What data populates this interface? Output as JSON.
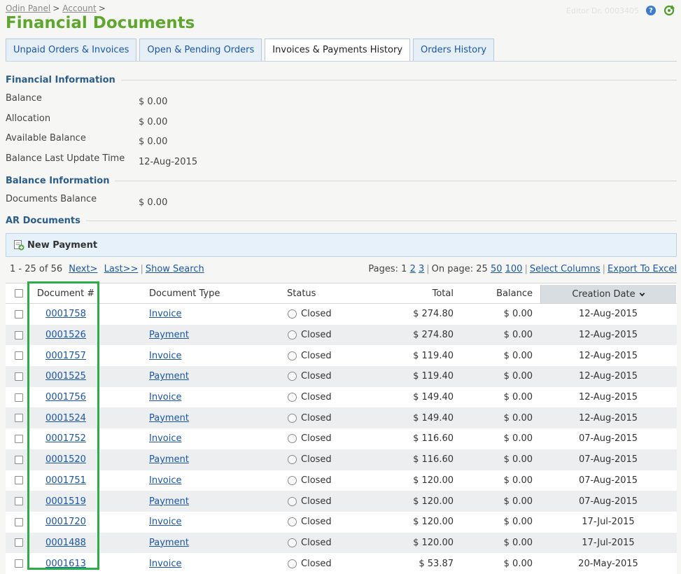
{
  "breadcrumb": {
    "items": [
      "Odin Panel",
      "Account"
    ],
    "separator": ">"
  },
  "header": {
    "faint_text": "Editor  Dr. 0003405",
    "help_icon": "help-icon",
    "refresh_icon": "refresh-icon",
    "title": "Financial Documents",
    "title_color": "#5fa62c"
  },
  "tabs": [
    {
      "label": "Unpaid Orders & Invoices",
      "active": false
    },
    {
      "label": "Open & Pending Orders",
      "active": false
    },
    {
      "label": "Invoices & Payments History",
      "active": true
    },
    {
      "label": "Orders History",
      "active": false
    }
  ],
  "financial_info": {
    "title": "Financial Information",
    "rows": [
      {
        "label": "Balance",
        "value": "$ 0.00"
      },
      {
        "label": "Allocation",
        "value": "$ 0.00"
      },
      {
        "label": "Available Balance",
        "value": "$ 0.00"
      },
      {
        "label": "Balance Last Update Time",
        "value": "12-Aug-2015"
      }
    ]
  },
  "balance_info": {
    "title": "Balance Information",
    "rows": [
      {
        "label": "Documents Balance",
        "value": "$ 0.00"
      }
    ]
  },
  "ar_documents": {
    "title": "AR Documents",
    "new_payment_label": "New Payment",
    "new_payment_icon": "add-document-icon"
  },
  "pager": {
    "range": "1 -  25 of 56",
    "next": "Next>",
    "last": "Last>>",
    "show_search": "Show Search",
    "pages_label": "Pages: 1",
    "page2": "2",
    "page3": "3",
    "on_page_label": "On page: 25",
    "size50": "50",
    "size100": "100",
    "select_columns": "Select Columns",
    "export": "Export To Excel"
  },
  "table": {
    "columns": {
      "document": "Document #",
      "type": "Document Type",
      "status": "Status",
      "total": "Total",
      "balance": "Balance",
      "date": "Creation Date"
    },
    "sorted_column": "Creation Date",
    "sort_direction": "descending",
    "rows": [
      {
        "doc": "0001758",
        "type": "Invoice",
        "status": "Closed",
        "total": "$ 274.80",
        "balance": "$ 0.00",
        "date": "12-Aug-2015"
      },
      {
        "doc": "0001526",
        "type": "Payment",
        "status": "Closed",
        "total": "$ 274.80",
        "balance": "$ 0.00",
        "date": "12-Aug-2015"
      },
      {
        "doc": "0001757",
        "type": "Invoice",
        "status": "Closed",
        "total": "$ 119.40",
        "balance": "$ 0.00",
        "date": "12-Aug-2015"
      },
      {
        "doc": "0001525",
        "type": "Payment",
        "status": "Closed",
        "total": "$ 119.40",
        "balance": "$ 0.00",
        "date": "12-Aug-2015"
      },
      {
        "doc": "0001756",
        "type": "Invoice",
        "status": "Closed",
        "total": "$ 149.40",
        "balance": "$ 0.00",
        "date": "12-Aug-2015"
      },
      {
        "doc": "0001524",
        "type": "Payment",
        "status": "Closed",
        "total": "$ 149.40",
        "balance": "$ 0.00",
        "date": "12-Aug-2015"
      },
      {
        "doc": "0001752",
        "type": "Invoice",
        "status": "Closed",
        "total": "$ 116.60",
        "balance": "$ 0.00",
        "date": "07-Aug-2015"
      },
      {
        "doc": "0001520",
        "type": "Payment",
        "status": "Closed",
        "total": "$ 116.60",
        "balance": "$ 0.00",
        "date": "07-Aug-2015"
      },
      {
        "doc": "0001751",
        "type": "Invoice",
        "status": "Closed",
        "total": "$ 120.00",
        "balance": "$ 0.00",
        "date": "07-Aug-2015"
      },
      {
        "doc": "0001519",
        "type": "Payment",
        "status": "Closed",
        "total": "$ 120.00",
        "balance": "$ 0.00",
        "date": "07-Aug-2015"
      },
      {
        "doc": "0001720",
        "type": "Invoice",
        "status": "Closed",
        "total": "$ 120.00",
        "balance": "$ 0.00",
        "date": "17-Jul-2015"
      },
      {
        "doc": "0001488",
        "type": "Payment",
        "status": "Closed",
        "total": "$ 120.00",
        "balance": "$ 0.00",
        "date": "17-Jul-2015"
      },
      {
        "doc": "0001613",
        "type": "Invoice",
        "status": "Closed",
        "total": "$ 53.87",
        "balance": "$ 0.00",
        "date": "20-May-2015"
      }
    ]
  },
  "highlight_color": "#2bae4a"
}
